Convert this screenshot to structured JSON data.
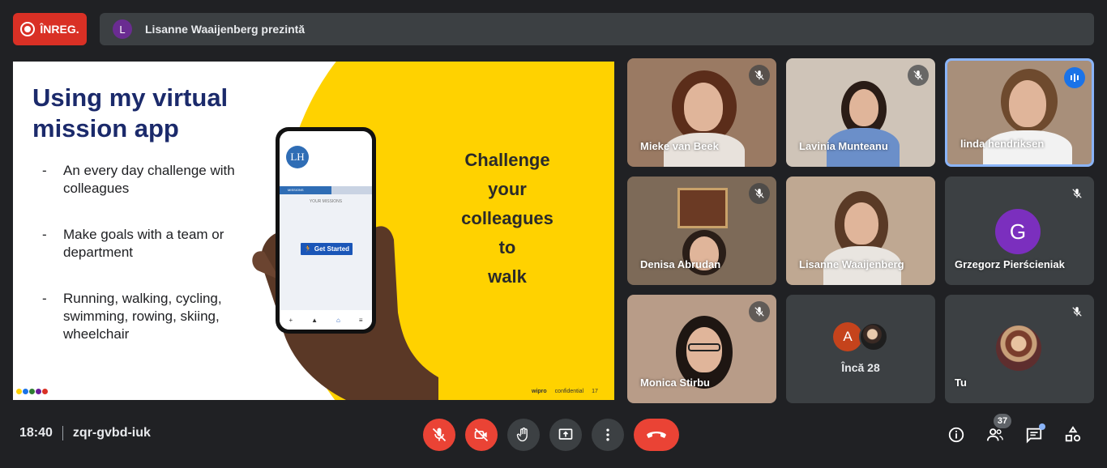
{
  "recording": {
    "label": "ÎNREG.",
    "color": "#d93025"
  },
  "presenting": {
    "avatar_letter": "L",
    "text": "Lisanne Waaijenberg prezintă"
  },
  "slide": {
    "title": "Using my virtual mission app",
    "bullets": [
      "An every day challenge with colleagues",
      "Make goals with a team or department",
      "Running, walking, cycling, swimming, rowing, skiing, wheelchair"
    ],
    "challenge_lines": [
      "Challenge",
      "your",
      "colleagues",
      "to",
      "walk"
    ],
    "phone": {
      "initials": "LH",
      "missions_tab": "MISSIONS",
      "your_missions": "YOUR MISSIONS",
      "get_started": "Get Started"
    },
    "footer_brand": "wipro",
    "footer_confidential": "confidential",
    "page_number": "17"
  },
  "participants": [
    {
      "name": "Mieke van Beek",
      "muted": true
    },
    {
      "name": "Lavinia Munteanu",
      "muted": true
    },
    {
      "name": "linda hendriksen",
      "muted": false,
      "speaking": true
    },
    {
      "name": "Denisa Abrudan",
      "muted": true
    },
    {
      "name": "Lisanne Waaijenberg",
      "muted": false
    },
    {
      "name": "Grzegorz Pierścieniak",
      "avatar_letter": "G",
      "muted": true
    },
    {
      "name": "Monica Stirbu",
      "muted": true
    },
    {
      "more_label": "Încă 28",
      "avatar_letter": "A"
    },
    {
      "name": "Tu",
      "muted": true
    }
  ],
  "bottom": {
    "time": "18:40",
    "meeting_code": "zqr-gvbd-iuk",
    "people_count": "37"
  },
  "colors": {
    "accent": "#1a73e8",
    "danger": "#ea4335",
    "slide_yellow": "#ffd200",
    "slide_title": "#1b2a6b"
  },
  "icons": [
    "record-icon",
    "mic-off-icon",
    "camera-off-icon",
    "hand-icon",
    "present-icon",
    "more-icon",
    "hangup-icon",
    "info-icon",
    "people-icon",
    "chat-icon",
    "activities-icon"
  ]
}
